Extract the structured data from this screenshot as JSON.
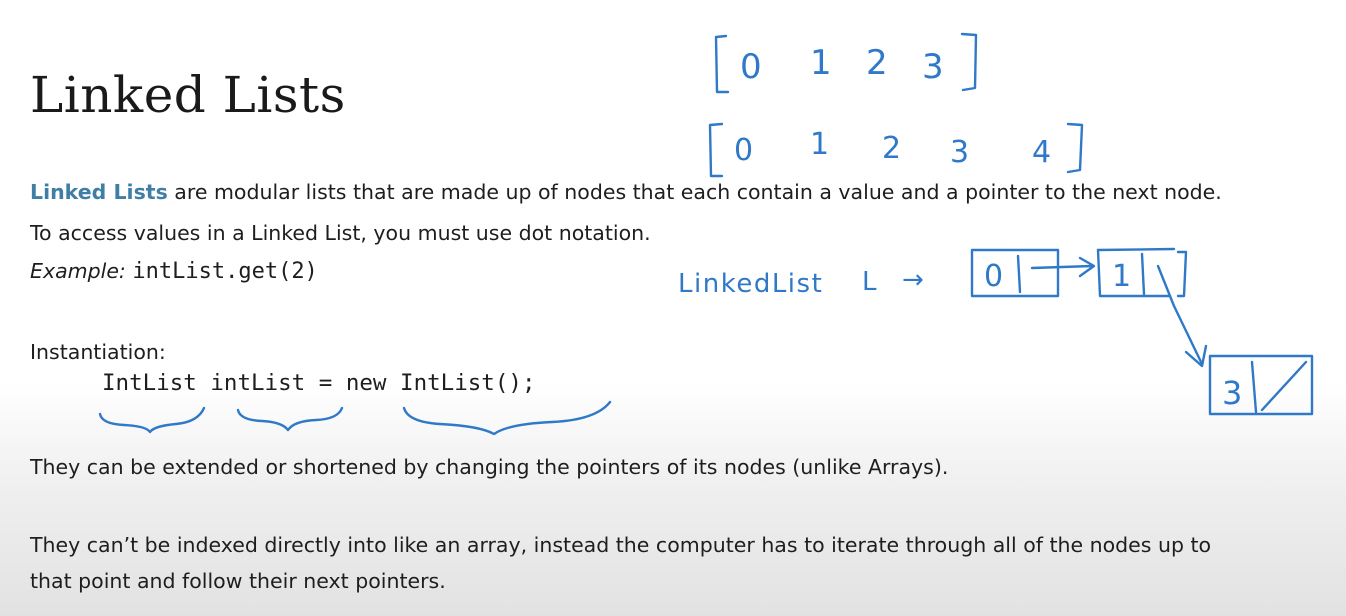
{
  "slide": {
    "title": "Linked Lists",
    "definition": {
      "term": "Linked Lists",
      "rest": " are modular lists that are made up of nodes that each contain a value and a pointer to the next node."
    },
    "access_line": "To access values in a Linked List, you must use dot notation.",
    "example": {
      "label": "Example:",
      "code": "intList.get(2)"
    },
    "instantiation_label": "Instantiation:",
    "instantiation_code": {
      "type": "IntList",
      "name": "intList",
      "assign": "=",
      "new_kw": "new",
      "ctor": "IntList()",
      "semicolon": ";"
    },
    "point_1": "They can be extended or shortened by changing the pointers of its nodes (unlike Arrays).",
    "point_2_line_1": "They can’t be indexed directly into like an array, instead the computer has to iterate through all of the nodes up to",
    "point_2_line_2": "that point and follow their next pointers."
  },
  "annotations": {
    "ink_color": "#2f79c8",
    "array_1": [
      "0",
      "1",
      "2",
      "3"
    ],
    "array_2": [
      "0",
      "1",
      "2",
      "3",
      "4"
    ],
    "linked_list_label": "LinkedList",
    "variable": "L",
    "arrow_glyph": "→",
    "nodes": [
      "0",
      "1",
      "3"
    ]
  }
}
